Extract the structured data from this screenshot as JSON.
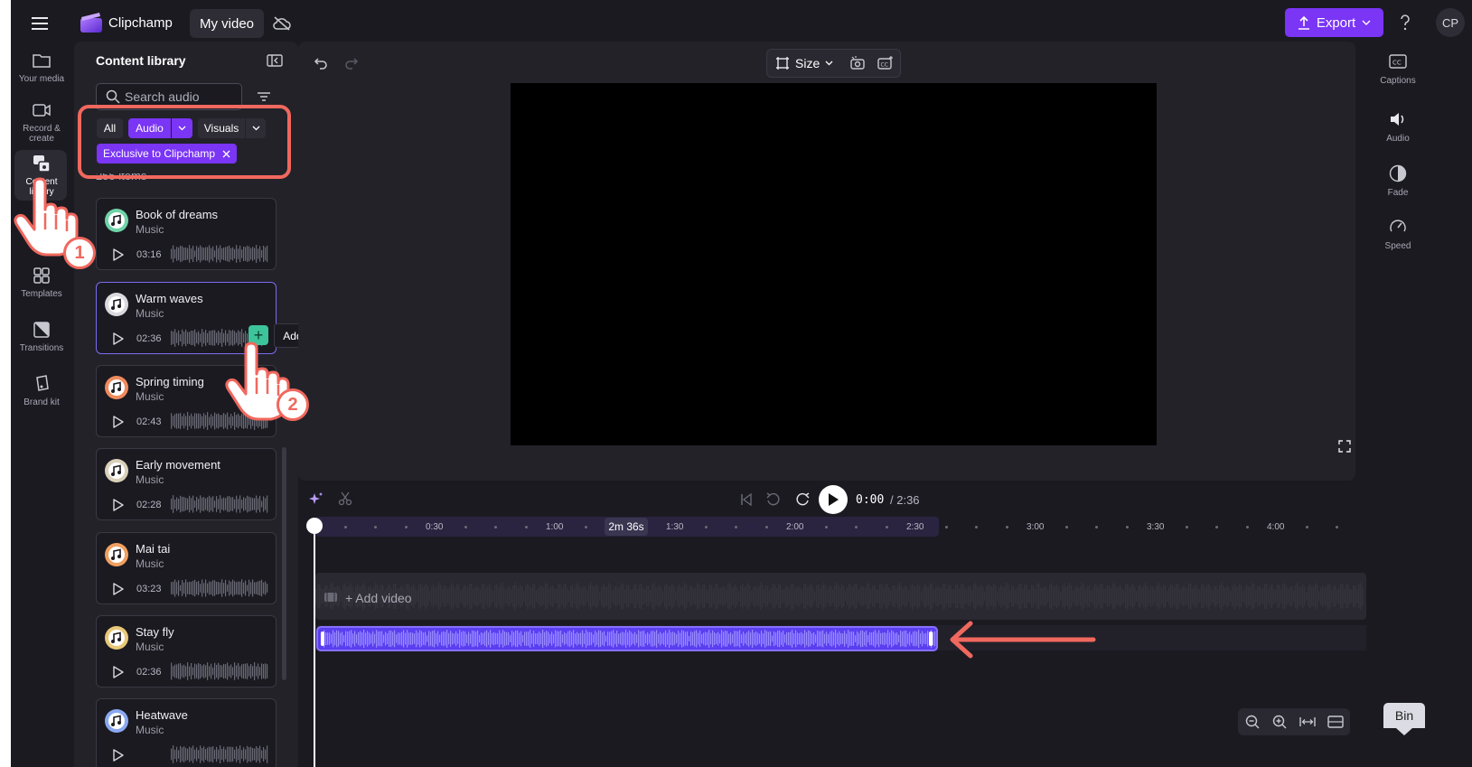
{
  "topbar": {
    "brand": "Clipchamp",
    "project_tab": "My video",
    "export_label": "Export",
    "avatar_initials": "CP"
  },
  "left_nav": [
    {
      "label": "Your media",
      "icon": "folder-icon"
    },
    {
      "label": "Record & create",
      "icon": "camera-icon"
    },
    {
      "label": "Content library",
      "icon": "content-library-icon",
      "active": true
    },
    {
      "label": "Templates",
      "icon": "templates-icon"
    },
    {
      "label": "Transitions",
      "icon": "transitions-icon"
    },
    {
      "label": "Brand kit",
      "icon": "brand-kit-icon"
    }
  ],
  "content_library": {
    "title": "Content library",
    "search_placeholder": "Search audio",
    "filters": {
      "all": "All",
      "audio": "Audio",
      "visuals": "Visuals",
      "exclusive": "Exclusive to Clipchamp"
    },
    "items_count": "255 items",
    "tooltip": "Add to timeline",
    "tracks": [
      {
        "title": "Book of dreams",
        "category": "Music",
        "duration": "03:16",
        "icon_color": "#6fd3a8"
      },
      {
        "title": "Warm waves",
        "category": "Music",
        "duration": "02:36",
        "icon_color": "#d9d9e0"
      },
      {
        "title": "Spring timing",
        "category": "Music",
        "duration": "02:43",
        "icon_color": "#f08a5d"
      },
      {
        "title": "Early movement",
        "category": "Music",
        "duration": "02:28",
        "icon_color": "#d8d0b8"
      },
      {
        "title": "Mai tai",
        "category": "Music",
        "duration": "03:23",
        "icon_color": "#f0a060"
      },
      {
        "title": "Stay fly",
        "category": "Music",
        "duration": "02:36",
        "icon_color": "#e8c878"
      },
      {
        "title": "Heatwave",
        "category": "Music",
        "duration": "",
        "icon_color": "#8aa8f0"
      }
    ]
  },
  "preview": {
    "size_label": "Size"
  },
  "right_panel": [
    {
      "label": "Captions",
      "icon": "captions-icon"
    },
    {
      "label": "Audio",
      "icon": "audio-icon"
    },
    {
      "label": "Fade",
      "icon": "fade-icon"
    },
    {
      "label": "Speed",
      "icon": "speed-icon"
    }
  ],
  "timeline": {
    "current_time": "0:00",
    "total_time": "/ 2:36",
    "duration_badge": "2m 36s",
    "add_video_label": "+ Add video",
    "ticks": [
      "0:30",
      "1:00",
      "1:30",
      "2:00",
      "2:30",
      "3:00",
      "3:30",
      "4:00"
    ],
    "bin_label": "Bin"
  },
  "annotations": {
    "step1": "1",
    "step2": "2"
  },
  "colors": {
    "accent": "#7a35f5",
    "highlight": "#f0685e",
    "add_button": "#3ec49a"
  }
}
